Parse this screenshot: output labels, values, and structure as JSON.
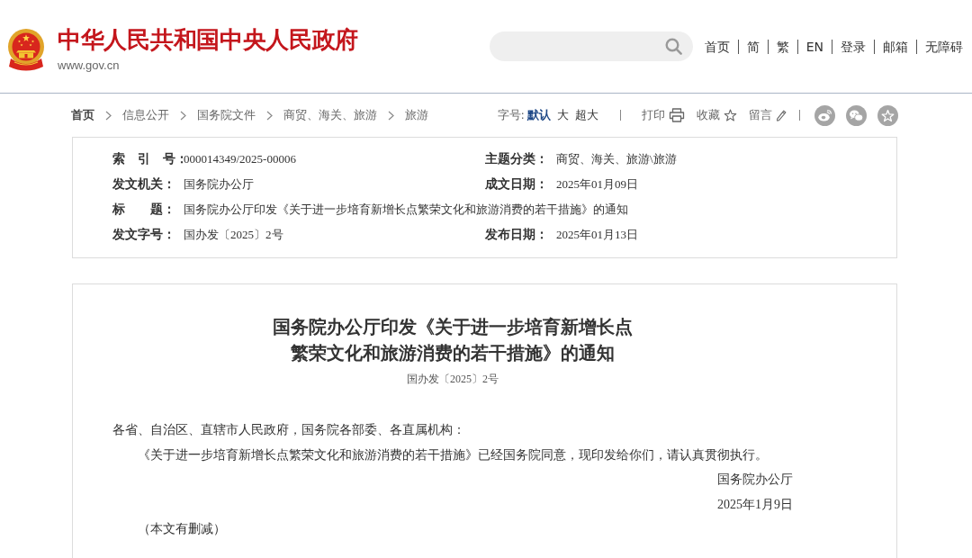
{
  "header": {
    "site_title": "中华人民共和国中央人民政府",
    "site_url": "www.gov.cn",
    "nav_links": [
      "首页",
      "简",
      "繁",
      "EN",
      "登录",
      "邮箱",
      "无障碍"
    ]
  },
  "toolbar": {
    "breadcrumb": [
      "首页",
      "信息公开",
      "国务院文件",
      "商贸、海关、旅游",
      "旅游"
    ],
    "font_size": {
      "label": "字号:",
      "options": [
        {
          "label": "默认",
          "selected": true
        },
        {
          "label": "大",
          "selected": false
        },
        {
          "label": "超大",
          "selected": false
        }
      ]
    },
    "actions": [
      {
        "kind": "print",
        "label": "打印"
      },
      {
        "kind": "favorite",
        "label": "收藏"
      },
      {
        "kind": "comment",
        "label": "留言"
      }
    ],
    "share": [
      {
        "kind": "weibo"
      },
      {
        "kind": "wechat"
      },
      {
        "kind": "favorite"
      }
    ]
  },
  "info": {
    "rows": [
      {
        "cells": [
          {
            "label": "索　引　号：",
            "value": "000014349/2025-00006"
          },
          {
            "label": "主题分类：",
            "value": "商贸、海关、旅游\\旅游"
          }
        ]
      },
      {
        "cells": [
          {
            "label": "发文机关：",
            "value": "国务院办公厅"
          },
          {
            "label": "成文日期：",
            "value": "2025年01月09日"
          }
        ]
      },
      {
        "cells": [
          {
            "label": "标　　题：",
            "value": "国务院办公厅印发《关于进一步培育新增长点繁荣文化和旅游消费的若干措施》的通知"
          }
        ]
      },
      {
        "cells": [
          {
            "label": "发文字号：",
            "value": "国办发〔2025〕2号"
          },
          {
            "label": "发布日期：",
            "value": "2025年01月13日"
          }
        ]
      }
    ]
  },
  "article": {
    "title_lines": [
      "国务院办公厅印发《关于进一步培育新增长点",
      "繁荣文化和旅游消费的若干措施》的通知"
    ],
    "doc_number": "国办发〔2025〕2号",
    "paragraphs": [
      {
        "kind": "salutation",
        "text": "各省、自治区、直辖市人民政府，国务院各部委、各直属机构："
      },
      {
        "kind": "body",
        "text": "《关于进一步培育新增长点繁荣文化和旅游消费的若干措施》已经国务院同意，现印发给你们，请认真贯彻执行。"
      },
      {
        "kind": "signature",
        "text": "国务院办公厅"
      },
      {
        "kind": "signature",
        "text": "2025年1月9日"
      },
      {
        "kind": "note",
        "text": "（本文有删减）"
      }
    ]
  }
}
